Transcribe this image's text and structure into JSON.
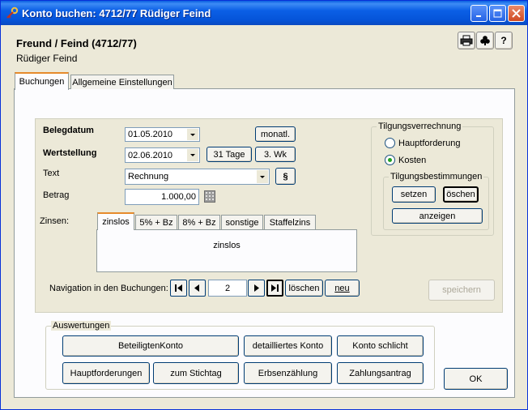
{
  "window": {
    "title": "Konto buchen: 4712/77 Rüdiger Feind"
  },
  "header": {
    "title": "Freund / Feind (4712/77)",
    "subtitle": "Rüdiger Feind",
    "print_icon": "printer-icon",
    "club_icon": "club-icon",
    "help_label": "?"
  },
  "tabs": [
    {
      "label": "Buchungen"
    },
    {
      "label": "Allgemeine Einstellungen"
    }
  ],
  "form": {
    "belegdatum_label": "Belegdatum",
    "belegdatum_value": "01.05.2010",
    "monatl_label": "monatl.",
    "wertstellung_label": "Wertstellung",
    "wertstellung_value": "02.06.2010",
    "tage_label": "31 Tage",
    "wk_label": "3. Wk",
    "text_label": "Text",
    "text_value": "Rechnung",
    "paragraph_label": "§",
    "betrag_label": "Betrag",
    "betrag_value": "1.000,00",
    "zinsen_label": "Zinsen:"
  },
  "zins_tabs": [
    {
      "label": "zinslos"
    },
    {
      "label": "5% + Bz"
    },
    {
      "label": "8% + Bz"
    },
    {
      "label": "sonstige"
    },
    {
      "label": "Staffelzins"
    }
  ],
  "zins_content": "zinslos",
  "navigation": {
    "label": "Navigation in den Buchungen:",
    "current": "2",
    "loeschen_label": "löschen",
    "neu_label": "neu"
  },
  "speichern_label": "speichern",
  "tilgung": {
    "title": "Tilgungsverrechnung",
    "options": [
      {
        "label": "Hauptforderung",
        "checked": false
      },
      {
        "label": "Kosten",
        "checked": true
      }
    ],
    "bestimmungen_title": "Tilgungsbestimmungen",
    "setzen_label": "setzen",
    "loeschen_label": "öschen",
    "anzeigen_label": "anzeigen"
  },
  "auswertungen": {
    "title": "Auswertungen",
    "buttons_row1": [
      "BeteiligtenKonto",
      "detailliertes Konto",
      "Konto schlicht"
    ],
    "buttons_row2": [
      "Hauptforderungen",
      "zum Stichtag",
      "Erbsenzählung",
      "Zahlungsantrag"
    ]
  },
  "ok_label": "OK"
}
